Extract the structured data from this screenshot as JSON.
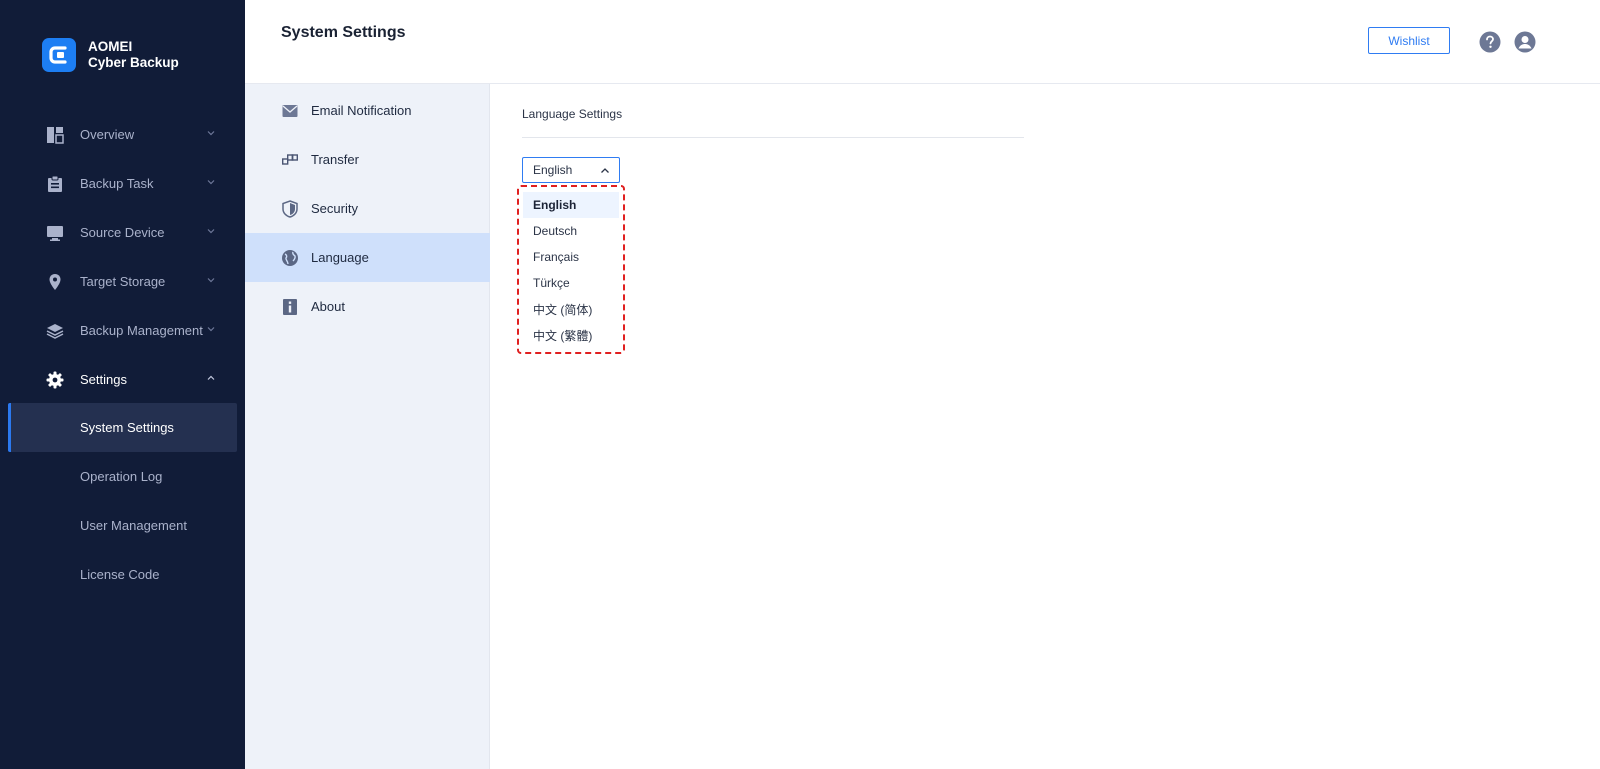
{
  "brand": {
    "line1": "AOMEI",
    "line2": "Cyber Backup"
  },
  "colors": {
    "sidebar_bg": "#111c38",
    "accent": "#2f7cf2",
    "highlight": "#e02020"
  },
  "sidebar": {
    "items": [
      {
        "label": "Overview",
        "icon": "dashboard-icon"
      },
      {
        "label": "Backup Task",
        "icon": "clipboard-icon"
      },
      {
        "label": "Source Device",
        "icon": "monitor-icon"
      },
      {
        "label": "Target Storage",
        "icon": "location-pin-icon"
      },
      {
        "label": "Backup Management",
        "icon": "layers-icon"
      },
      {
        "label": "Settings",
        "icon": "gear-icon",
        "expanded": true
      }
    ],
    "settings_children": [
      {
        "label": "System Settings",
        "active": true
      },
      {
        "label": "Operation Log"
      },
      {
        "label": "User Management"
      },
      {
        "label": "License Code"
      }
    ]
  },
  "header": {
    "title": "System Settings",
    "wishlist_label": "Wishlist",
    "help_icon": "question-circle-icon",
    "user_icon": "user-avatar-icon"
  },
  "submenu": {
    "items": [
      {
        "label": "Email Notification",
        "icon": "envelope-icon"
      },
      {
        "label": "Transfer",
        "icon": "transfer-icon"
      },
      {
        "label": "Security",
        "icon": "shield-icon"
      },
      {
        "label": "Language",
        "icon": "globe-icon",
        "active": true
      },
      {
        "label": "About",
        "icon": "info-icon"
      }
    ]
  },
  "content": {
    "section_title": "Language Settings",
    "language_select": {
      "value": "English",
      "options": [
        "English",
        "Deutsch",
        "Français",
        "Türkçe",
        "中文 (简体)",
        "中文 (繁體)"
      ],
      "selected_index": 0
    }
  }
}
